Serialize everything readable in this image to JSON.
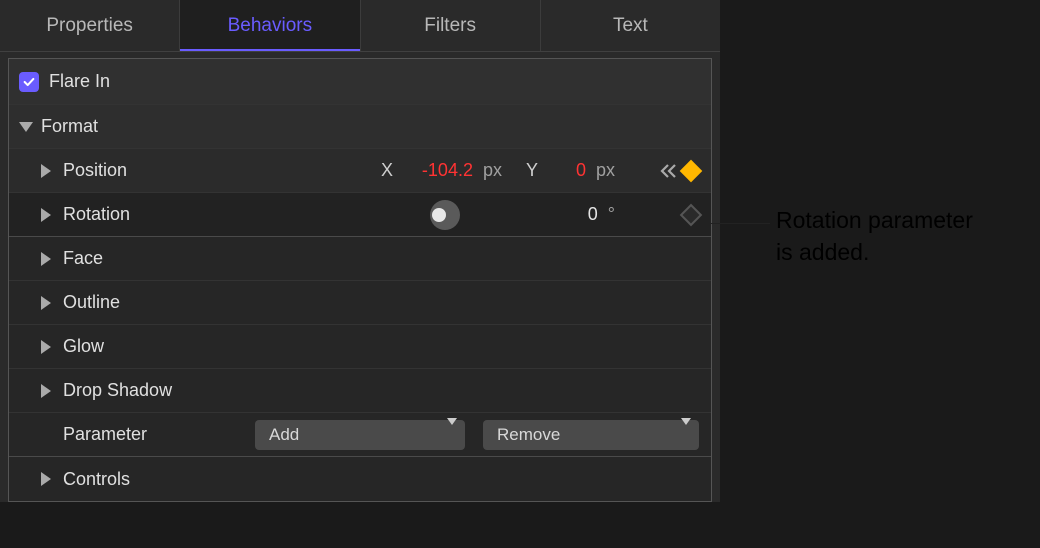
{
  "tabs": {
    "properties": "Properties",
    "behaviors": "Behaviors",
    "filters": "Filters",
    "text": "Text"
  },
  "header": {
    "title": "Flare In"
  },
  "sections": {
    "format": "Format",
    "position": "Position",
    "rotation": "Rotation",
    "face": "Face",
    "outline": "Outline",
    "glow": "Glow",
    "dropshadow": "Drop Shadow",
    "parameter": "Parameter",
    "controls": "Controls"
  },
  "position": {
    "x_label": "X",
    "x_value": "-104.2",
    "x_unit": "px",
    "y_label": "Y",
    "y_value": "0",
    "y_unit": "px"
  },
  "rotation": {
    "value": "0",
    "unit": "°"
  },
  "selects": {
    "add": "Add",
    "remove": "Remove"
  },
  "annotation": {
    "line1": "Rotation parameter",
    "line2": "is added."
  }
}
